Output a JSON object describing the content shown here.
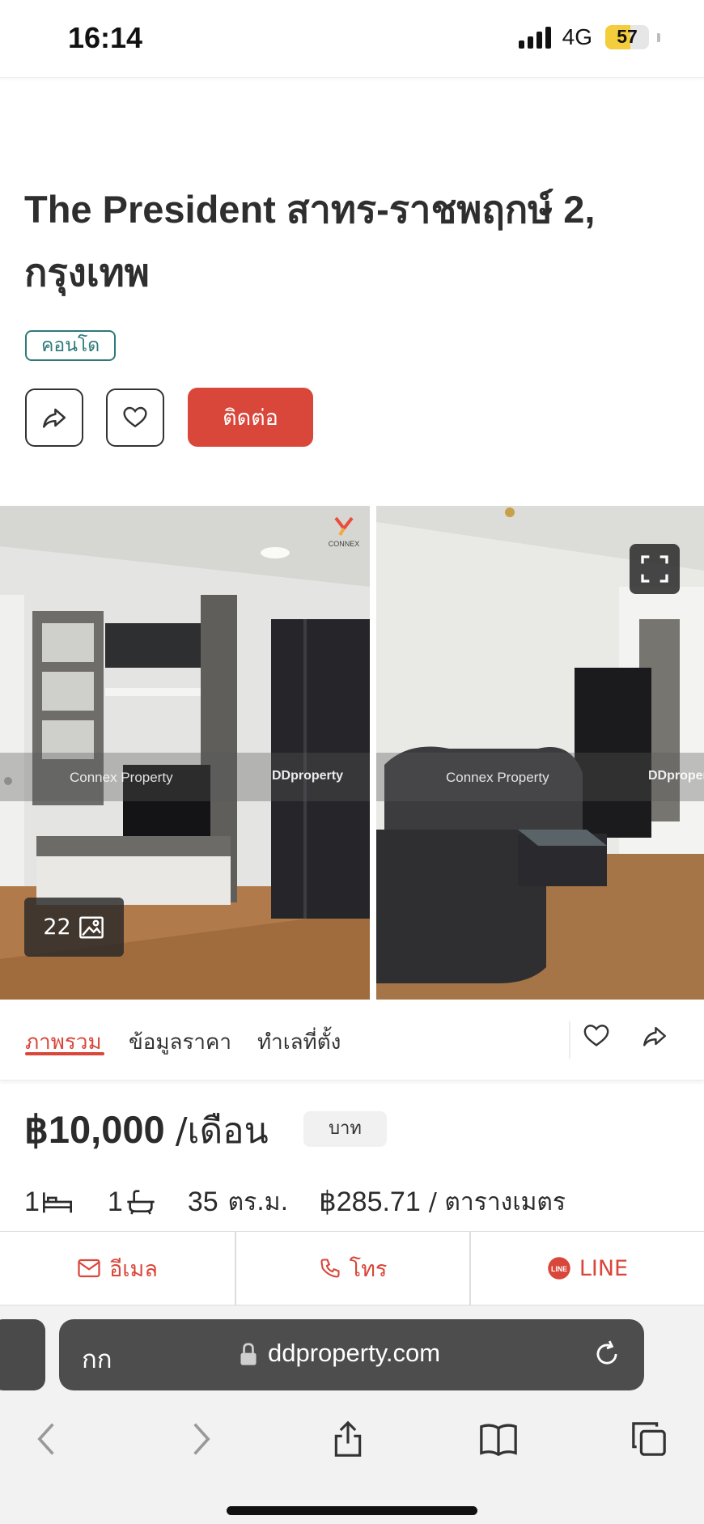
{
  "status_bar": {
    "time": "16:14",
    "network": "4G",
    "battery": "57",
    "battery_level_pct": 57
  },
  "listing": {
    "title": "The President สาทร-ราชพฤกษ์ 2, กรุงเทพ",
    "property_type": "คอนโด",
    "contact_label": "ติดต่อ"
  },
  "gallery": {
    "photo_count": "22",
    "watermark_agent": "Connex Property",
    "watermark_site": "DDproperty",
    "logo_text": "CONNEX"
  },
  "tabs": [
    {
      "label": "ภาพรวม",
      "active": true
    },
    {
      "label": "ข้อมูลราคา",
      "active": false
    },
    {
      "label": "ทำเลที่ตั้ง",
      "active": false
    }
  ],
  "price": {
    "amount": "฿10,000",
    "period": "/เดือน",
    "currency_badge": "บาท"
  },
  "specs": {
    "bedrooms": "1",
    "bathrooms": "1",
    "area_value": "35",
    "area_unit": "ตร.ม.",
    "price_per_area": "฿285.71",
    "price_per_area_unit": "/ ตารางเมตร"
  },
  "actions": {
    "email": "อีเมล",
    "call": "โทร",
    "line": "LINE",
    "line_icon_text": "LINE"
  },
  "browser": {
    "text_size_label": "กก",
    "url": "ddproperty.com"
  },
  "colors": {
    "accent": "#d9463a",
    "tag": "#2e7a7a",
    "battery": "#f4cd3d"
  }
}
